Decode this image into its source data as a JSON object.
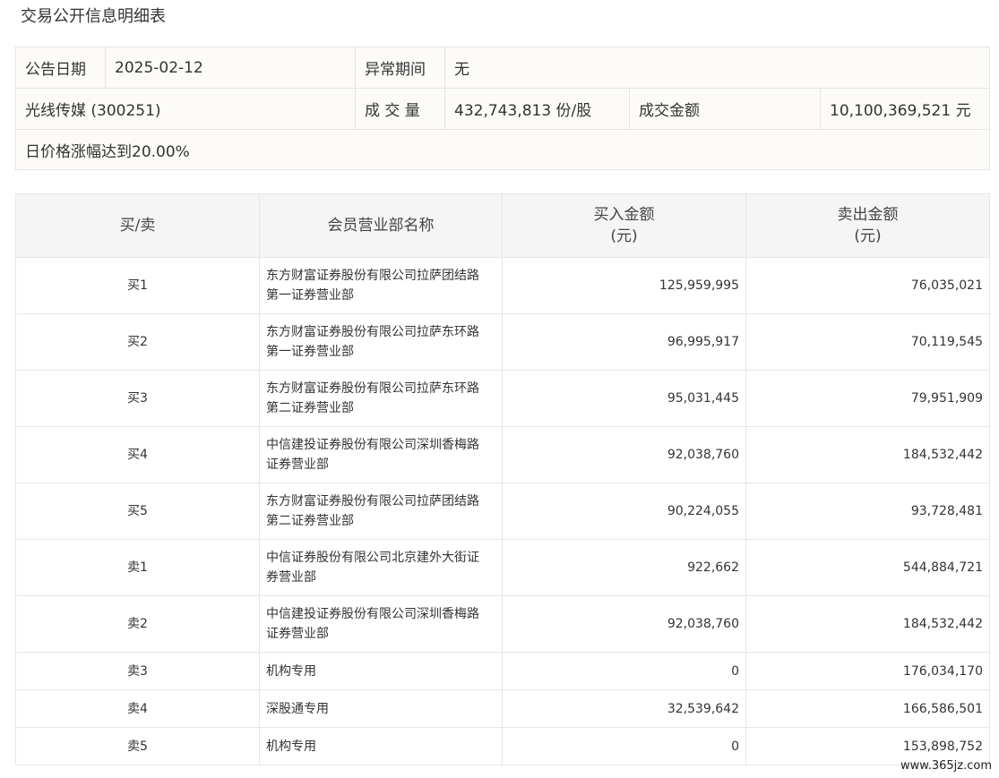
{
  "page_title": "交易公开信息明细表",
  "summary": {
    "announce_date_label": "公告日期",
    "announce_date": "2025-02-12",
    "abnormal_period_label": "异常期间",
    "abnormal_period": "无",
    "stock": "光线传媒 (300251)",
    "volume_label": "成 交 量",
    "volume": "432,743,813 份/股",
    "amount_label": "成交金额",
    "amount": "10,100,369,521 元",
    "reason": "日价格涨幅达到20.00%"
  },
  "table": {
    "headers": {
      "side": "买/卖",
      "member": "会员营业部名称",
      "buy_line1": "买入金额",
      "buy_line2": "(元)",
      "sell_line1": "卖出金额",
      "sell_line2": "(元)"
    },
    "rows": [
      {
        "side": "买1",
        "member_line1": "东方财富证券股份有限公司拉萨团结路",
        "member_line2": "第一证券营业部",
        "buy": "125,959,995",
        "sell": "76,035,021"
      },
      {
        "side": "买2",
        "member_line1": "东方财富证券股份有限公司拉萨东环路",
        "member_line2": "第一证券营业部",
        "buy": "96,995,917",
        "sell": "70,119,545"
      },
      {
        "side": "买3",
        "member_line1": "东方财富证券股份有限公司拉萨东环路",
        "member_line2": "第二证券营业部",
        "buy": "95,031,445",
        "sell": "79,951,909"
      },
      {
        "side": "买4",
        "member_line1": "中信建投证券股份有限公司深圳香梅路",
        "member_line2": "证券营业部",
        "buy": "92,038,760",
        "sell": "184,532,442"
      },
      {
        "side": "买5",
        "member_line1": "东方财富证券股份有限公司拉萨团结路",
        "member_line2": "第二证券营业部",
        "buy": "90,224,055",
        "sell": "93,728,481"
      },
      {
        "side": "卖1",
        "member_line1": "中信证券股份有限公司北京建外大街证",
        "member_line2": "券营业部",
        "buy": "922,662",
        "sell": "544,884,721"
      },
      {
        "side": "卖2",
        "member_line1": "中信建投证券股份有限公司深圳香梅路",
        "member_line2": "证券营业部",
        "buy": "92,038,760",
        "sell": "184,532,442"
      },
      {
        "side": "卖3",
        "member_line1": "机构专用",
        "member_line2": "",
        "buy": "0",
        "sell": "176,034,170"
      },
      {
        "side": "卖4",
        "member_line1": "深股通专用",
        "member_line2": "",
        "buy": "32,539,642",
        "sell": "166,586,501"
      },
      {
        "side": "卖5",
        "member_line1": "机构专用",
        "member_line2": "",
        "buy": "0",
        "sell": "153,898,752"
      }
    ]
  },
  "watermark": "www.365jz.com"
}
